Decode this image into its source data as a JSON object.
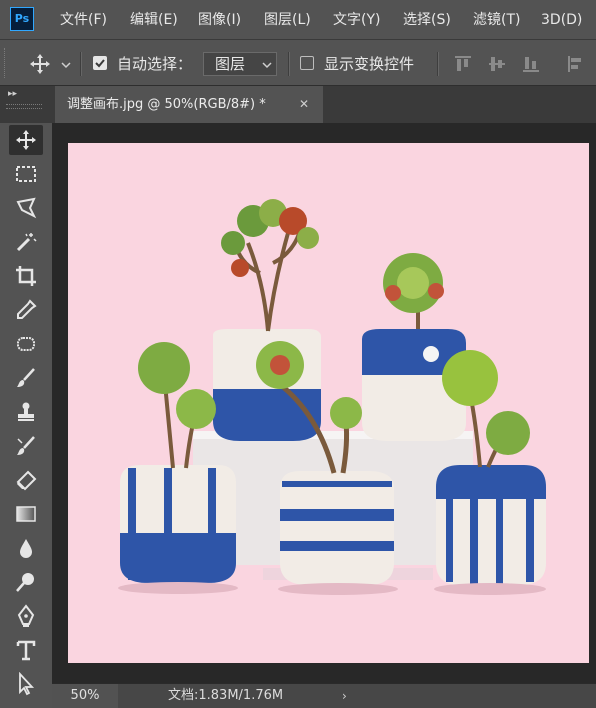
{
  "app": {
    "logo_text": "Ps",
    "accent_color": "#31a8ff"
  },
  "menu": [
    "文件(F)",
    "编辑(E)",
    "图像(I)",
    "图层(L)",
    "文字(Y)",
    "选择(S)",
    "滤镜(T)",
    "3D(D)"
  ],
  "options": {
    "auto_select_label": "自动选择：",
    "auto_select_checked": true,
    "auto_select_target": "图层",
    "show_transform_label": "显示变换控件",
    "show_transform_checked": false
  },
  "document": {
    "tab_title": "调整画布.jpg @ 50%(RGB/8#) *",
    "canvas_color": "#fad5e0"
  },
  "status": {
    "zoom": "50%",
    "doc_info": "文档:1.83M/1.76M",
    "arrow": "›"
  },
  "tools": [
    "move-tool-icon",
    "rectangular-marquee-icon",
    "lasso-icon",
    "magic-wand-icon",
    "crop-icon",
    "eyedropper-icon",
    "healing-brush-icon",
    "brush-icon",
    "clone-stamp-icon",
    "history-brush-icon",
    "eraser-icon",
    "gradient-icon",
    "blur-icon",
    "dodge-icon",
    "pen-icon",
    "type-icon",
    "path-selection-icon"
  ]
}
